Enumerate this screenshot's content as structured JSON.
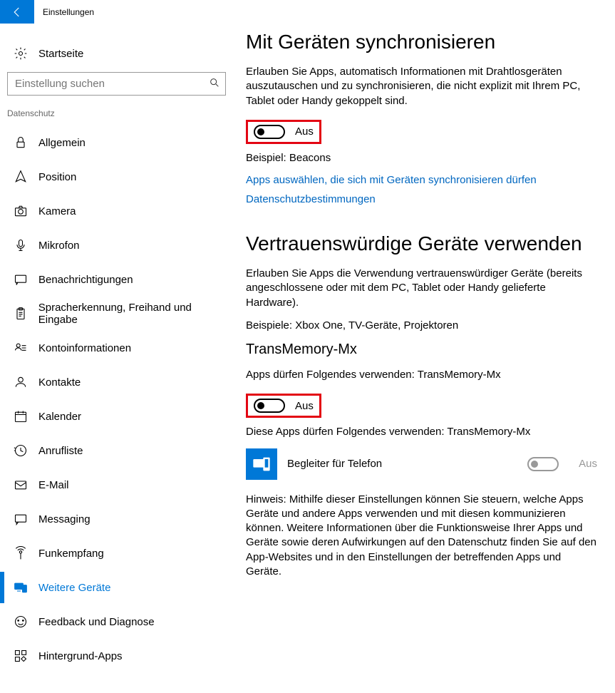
{
  "titlebar": {
    "title": "Einstellungen"
  },
  "sidebar": {
    "home_label": "Startseite",
    "search_placeholder": "Einstellung suchen",
    "group_label": "Datenschutz",
    "items": [
      {
        "label": "Allgemein"
      },
      {
        "label": "Position"
      },
      {
        "label": "Kamera"
      },
      {
        "label": "Mikrofon"
      },
      {
        "label": "Benachrichtigungen"
      },
      {
        "label": "Spracherkennung, Freihand und Eingabe"
      },
      {
        "label": "Kontoinformationen"
      },
      {
        "label": "Kontakte"
      },
      {
        "label": "Kalender"
      },
      {
        "label": "Anrufliste"
      },
      {
        "label": "E-Mail"
      },
      {
        "label": "Messaging"
      },
      {
        "label": "Funkempfang"
      },
      {
        "label": "Weitere Geräte"
      },
      {
        "label": "Feedback und Diagnose"
      },
      {
        "label": "Hintergrund-Apps"
      }
    ]
  },
  "content": {
    "section1": {
      "heading": "Mit Geräten synchronisieren",
      "desc": "Erlauben Sie Apps, automatisch Informationen mit Drahtlosgeräten auszutauschen und zu synchronisieren, die nicht explizit mit Ihrem PC, Tablet oder Handy gekoppelt sind.",
      "toggle_label": "Aus",
      "example": "Beispiel: Beacons",
      "link1": "Apps auswählen, die sich mit Geräten synchronisieren dürfen",
      "link2": "Datenschutzbestimmungen"
    },
    "section2": {
      "heading": "Vertrauenswürdige Geräte verwenden",
      "desc": "Erlauben Sie Apps die Verwendung vertrauenswürdiger Geräte (bereits angeschlossene oder mit dem PC, Tablet oder Handy gelieferte Hardware).",
      "example": "Beispiele: Xbox One, TV-Geräte, Projektoren",
      "device_heading": "TransMemory-Mx",
      "device_permission": "Apps dürfen Folgendes verwenden: TransMemory-Mx",
      "toggle_label": "Aus",
      "device_apps_label": "Diese Apps dürfen Folgendes verwenden: TransMemory-Mx",
      "app": {
        "name": "Begleiter für Telefon",
        "toggle_label": "Aus"
      },
      "note": "Hinweis: Mithilfe dieser Einstellungen können Sie steuern, welche Apps Geräte und andere Apps verwenden und mit diesen kommunizieren können. Weitere Informationen über die Funktionsweise Ihrer Apps und Geräte sowie deren Aufwirkungen auf den Datenschutz finden Sie auf den App-Websites und in den Einstellungen der betreffenden Apps und Geräte."
    }
  }
}
